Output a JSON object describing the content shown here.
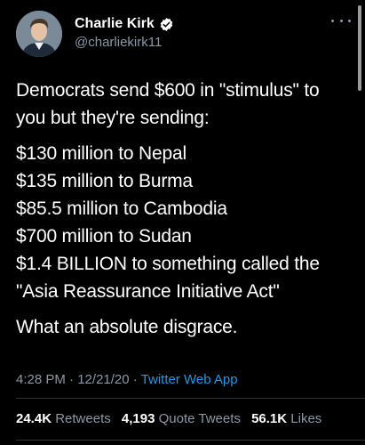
{
  "author": {
    "name": "Charlie Kirk",
    "handle": "@charliekirk11",
    "verified": true
  },
  "tweet": {
    "intro": "Democrats send $600 in \"stimulus\" to you but they're sending:",
    "lines": [
      "$130 million to Nepal",
      "$135 million to Burma",
      "$85.5 million to Cambodia",
      "$700 million to Sudan",
      "$1.4 BILLION to something called the \"Asia Reassurance Initiative Act\""
    ],
    "closing": "What an absolute disgrace."
  },
  "meta": {
    "time": "4:28 PM",
    "sep1": " · ",
    "date": "12/21/20",
    "sep2": " · ",
    "source": "Twitter Web App"
  },
  "stats": {
    "retweets_count": "24.4K",
    "retweets_label": "Retweets",
    "quotes_count": "4,193",
    "quotes_label": "Quote Tweets",
    "likes_count": "56.1K",
    "likes_label": "Likes"
  },
  "colors": {
    "background": "#000000",
    "text": "#ffffff",
    "secondary": "#8b98a5",
    "link": "#1d9bf0",
    "verified": "#ffffff"
  }
}
